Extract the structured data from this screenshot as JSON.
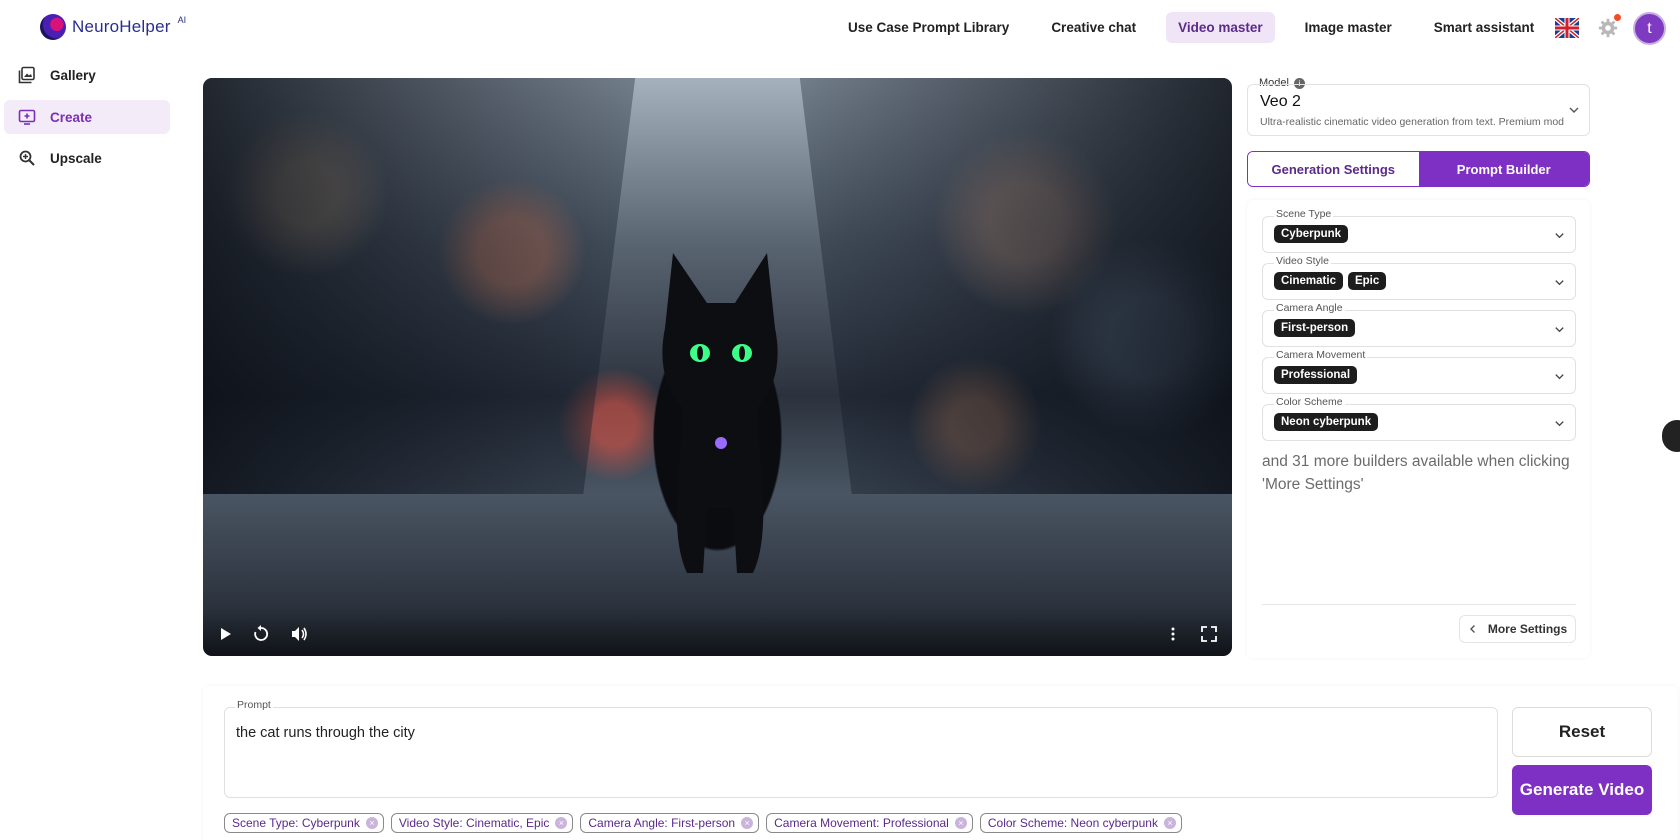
{
  "brand": {
    "name": "NeuroHelper",
    "suffix": "AI"
  },
  "nav": {
    "items": [
      {
        "label": "Use Case Prompt Library"
      },
      {
        "label": "Creative chat"
      },
      {
        "label": "Video master",
        "active": true
      },
      {
        "label": "Image master"
      },
      {
        "label": "Smart assistant"
      }
    ],
    "language_icon": "uk-flag-icon",
    "avatar_letter": "t"
  },
  "sidebar": {
    "items": [
      {
        "label": "Gallery",
        "icon": "gallery-icon"
      },
      {
        "label": "Create",
        "icon": "create-icon",
        "active": true
      },
      {
        "label": "Upscale",
        "icon": "upscale-icon"
      }
    ]
  },
  "video": {
    "controls": [
      "play-icon",
      "replay-icon",
      "volume-icon",
      "more-vertical-icon",
      "fullscreen-icon"
    ]
  },
  "model": {
    "label": "Model",
    "name": "Veo 2",
    "description": "Ultra-realistic cinematic video generation from text. Premium mod"
  },
  "tabs": {
    "generation": "Generation Settings",
    "prompt_builder": "Prompt Builder",
    "active": "prompt_builder"
  },
  "builders": [
    {
      "label": "Scene Type",
      "chips": [
        "Cyberpunk"
      ]
    },
    {
      "label": "Video Style",
      "chips": [
        "Cinematic",
        "Epic"
      ]
    },
    {
      "label": "Camera Angle",
      "chips": [
        "First-person"
      ]
    },
    {
      "label": "Camera Movement",
      "chips": [
        "Professional"
      ]
    },
    {
      "label": "Color Scheme",
      "chips": [
        "Neon cyberpunk"
      ]
    }
  ],
  "more_note": "and 31 more builders available when clicking 'More Settings'",
  "more_settings_label": "More Settings",
  "prompt": {
    "label": "Prompt",
    "value": "the cat runs through the city"
  },
  "actions": {
    "reset": "Reset",
    "generate": "Generate Video"
  },
  "tags": [
    "Scene Type: Cyberpunk",
    "Video Style: Cinematic, Epic",
    "Camera Angle: First-person",
    "Camera Movement: Professional",
    "Color Scheme: Neon cyberpunk"
  ],
  "colors": {
    "accent": "#7e2fc4",
    "accent_light": "#f0e4f7",
    "chip": "#1d1d1d"
  }
}
